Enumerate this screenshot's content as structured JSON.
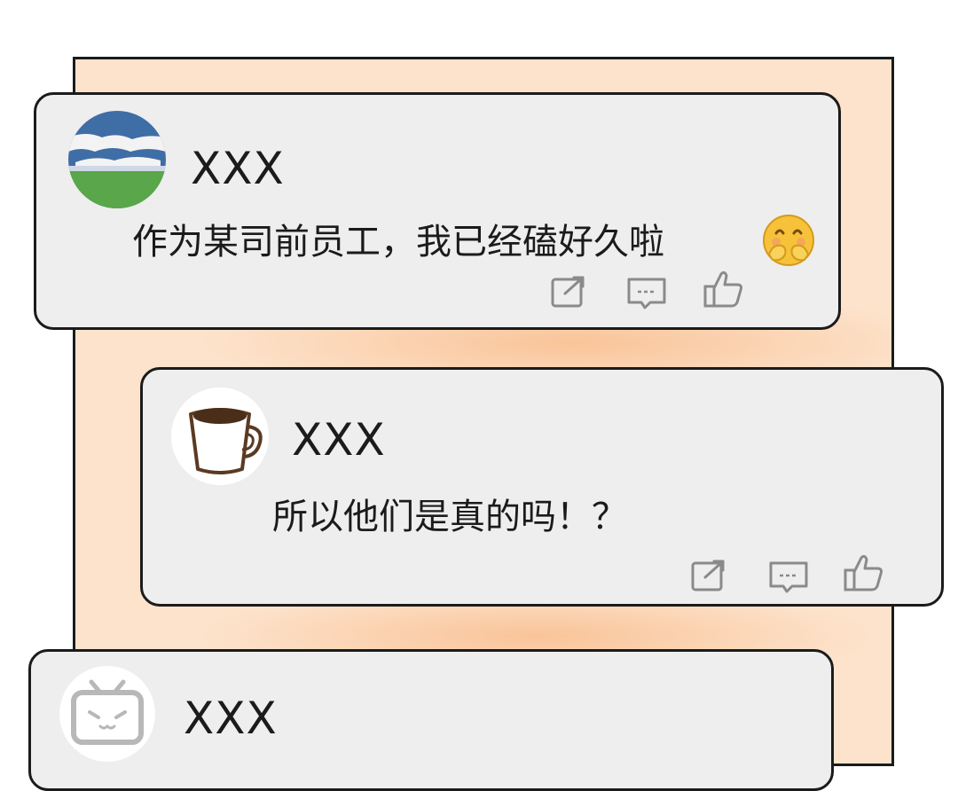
{
  "comments": [
    {
      "username": "XXX",
      "text": "作为某司前员工，我已经磕好久啦",
      "emoji": "hugging-face-emoji",
      "avatar": "landscape-sky-grass-icon"
    },
    {
      "username": "XXX",
      "text": "所以他们是真的吗！？",
      "avatar": "coffee-mug-icon"
    },
    {
      "username": "XXX",
      "text": "",
      "avatar": "bilibili-tv-icon"
    }
  ],
  "actions": {
    "share": "share-icon",
    "comment": "comment-icon",
    "like": "thumbs-up-icon"
  },
  "colors": {
    "panel_bg": "#fde3cc",
    "card_bg": "#eeeeee",
    "outline": "#1b1b1b",
    "icon_gray": "#8a8a8a"
  }
}
